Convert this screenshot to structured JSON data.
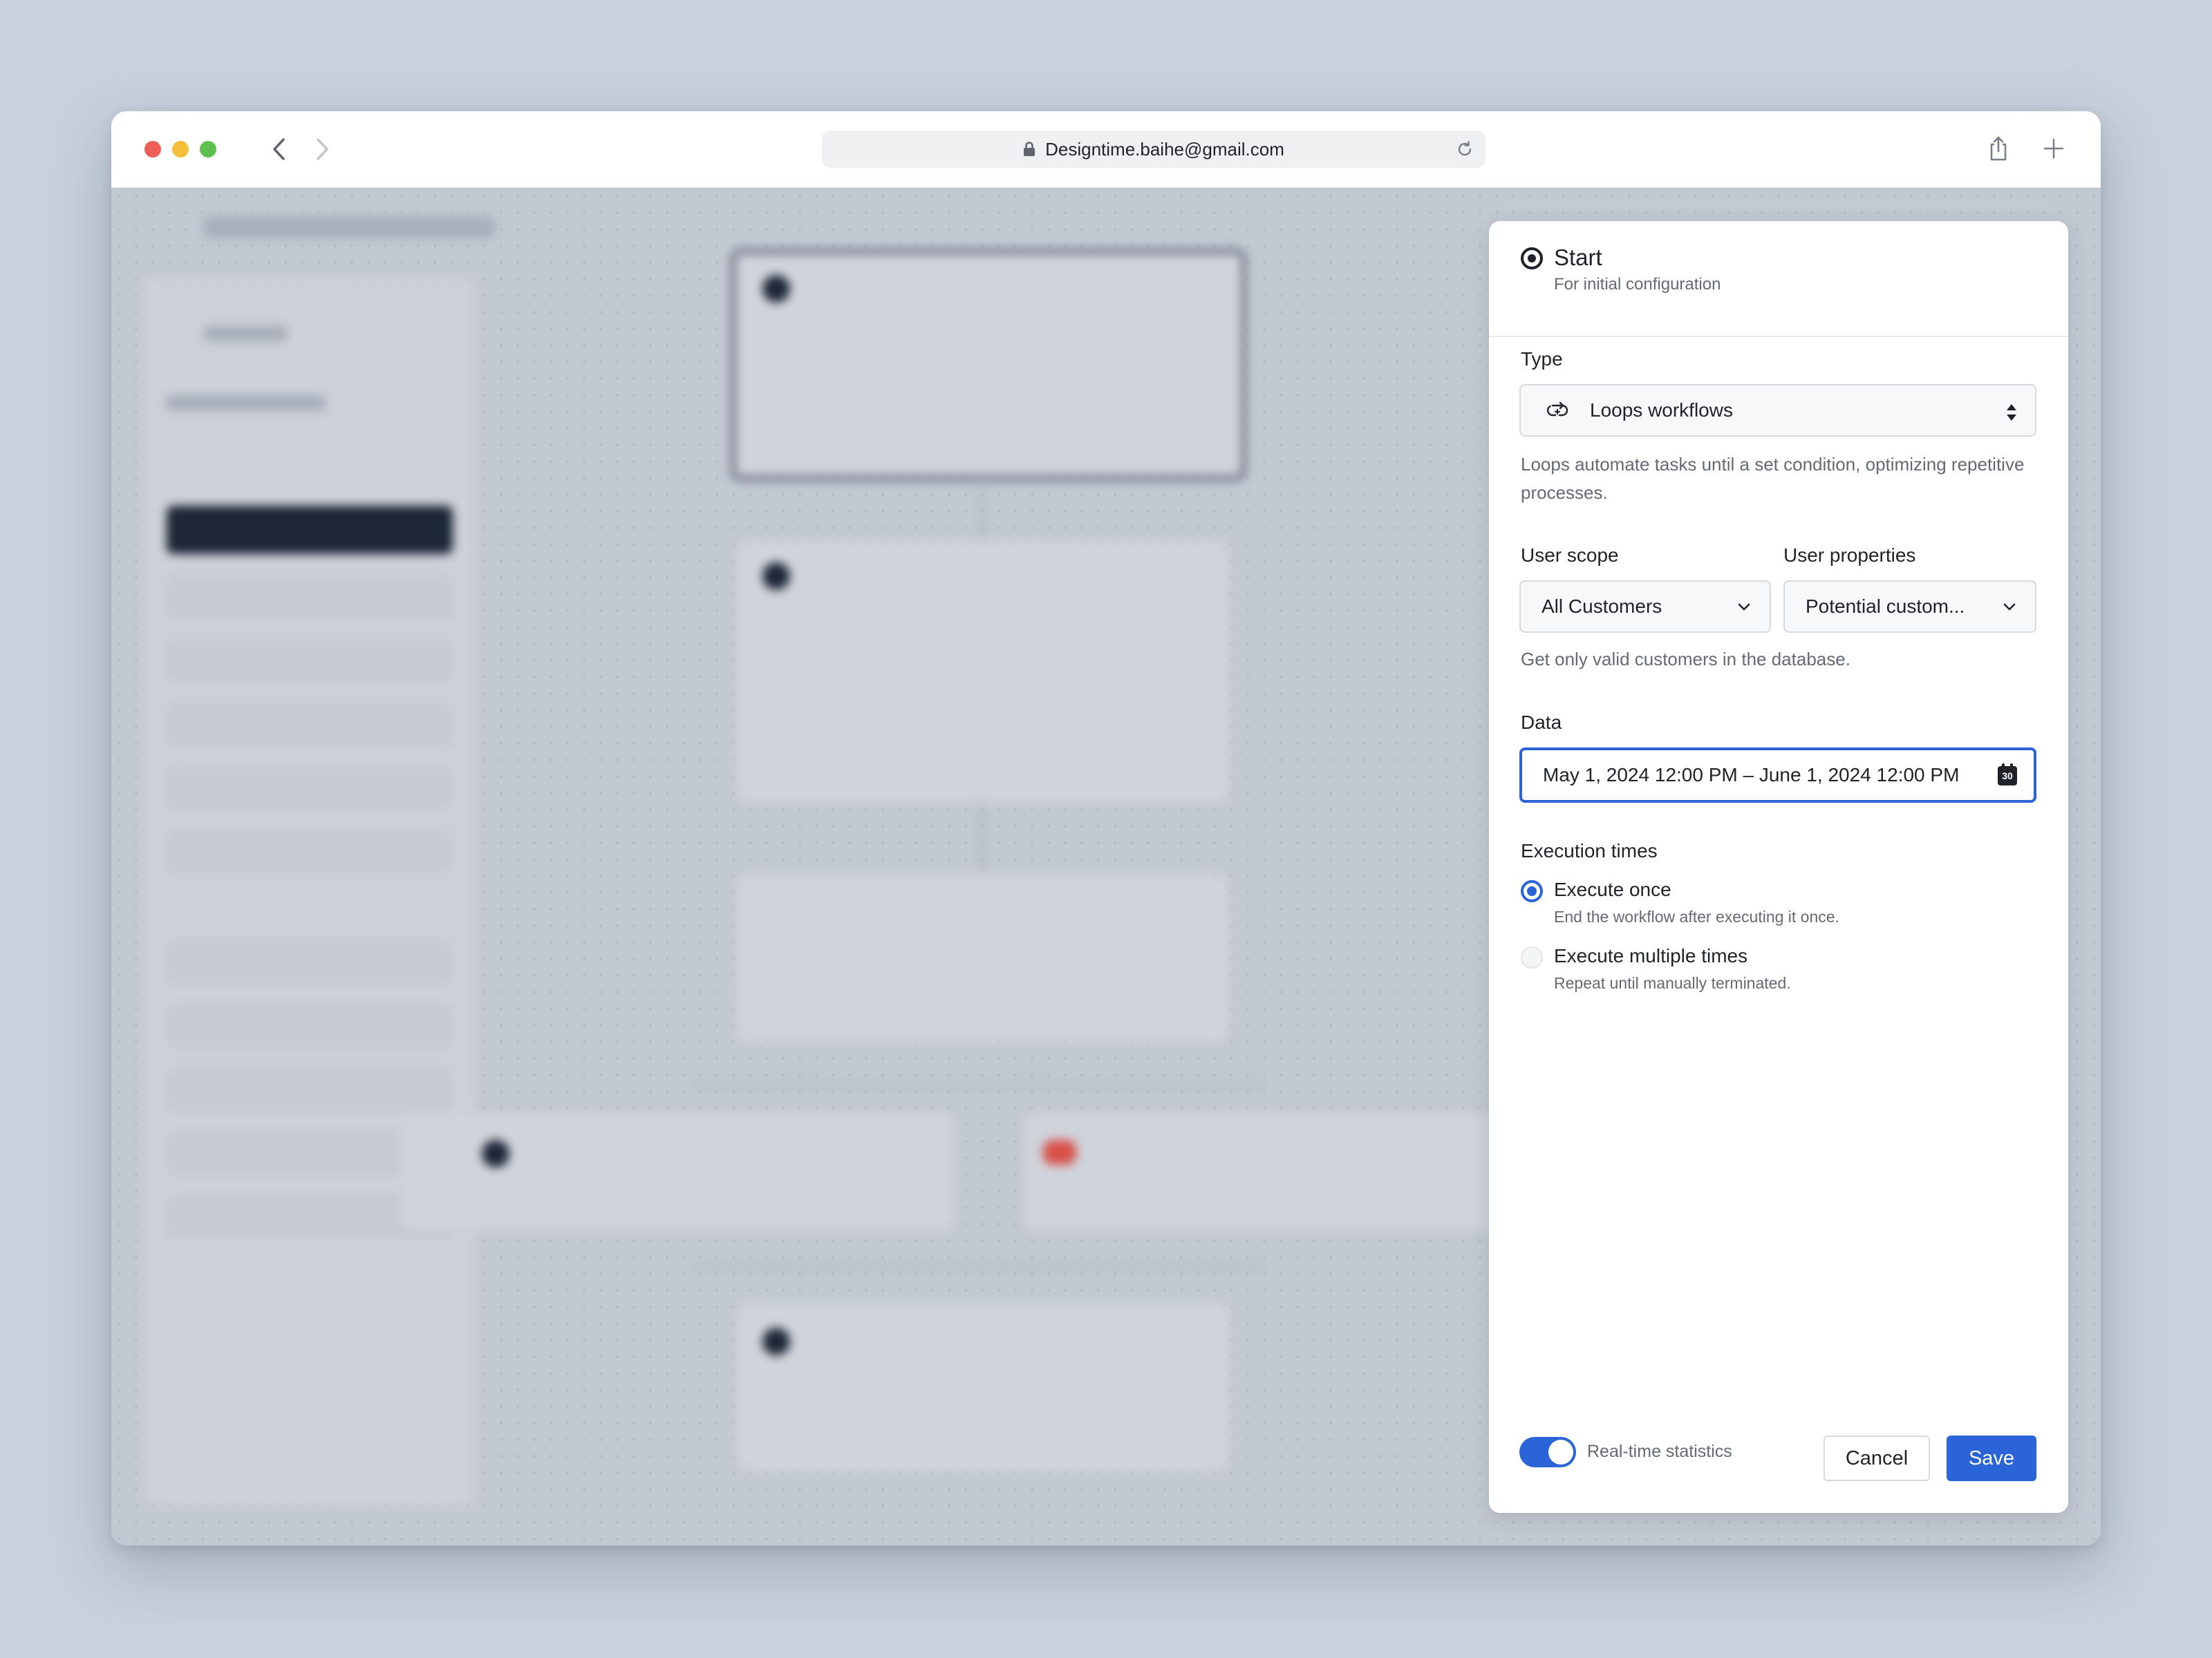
{
  "browser": {
    "url": "Designtime.baihe@gmail.com"
  },
  "panel": {
    "title": "Start",
    "subtitle": "For initial configuration",
    "type": {
      "label": "Type",
      "value": "Loops workflows",
      "help": "Loops automate tasks until a set condition, optimizing repetitive processes."
    },
    "user_scope": {
      "label": "User scope",
      "value": "All Customers"
    },
    "user_properties": {
      "label": "User properties",
      "value": "Potential custom..."
    },
    "scope_help": "Get only valid customers in the database.",
    "data": {
      "label": "Data",
      "value": "May 1, 2024 12:00 PM – June 1, 2024 12:00 PM",
      "calendar_day": "30"
    },
    "execution": {
      "label": "Execution times",
      "options": [
        {
          "title": "Execute once",
          "subtitle": "End the workflow after executing it once.",
          "selected": true
        },
        {
          "title": "Execute multiple times",
          "subtitle": "Repeat until manually terminated.",
          "selected": false
        }
      ]
    },
    "footer": {
      "realtime_label": "Real-time statistics",
      "realtime_on": true,
      "cancel_label": "Cancel",
      "save_label": "Save"
    }
  },
  "colors": {
    "accent": "#2a64d6",
    "backdrop": "#c9d1dd",
    "text": "#1f2329",
    "muted": "#646a73"
  }
}
